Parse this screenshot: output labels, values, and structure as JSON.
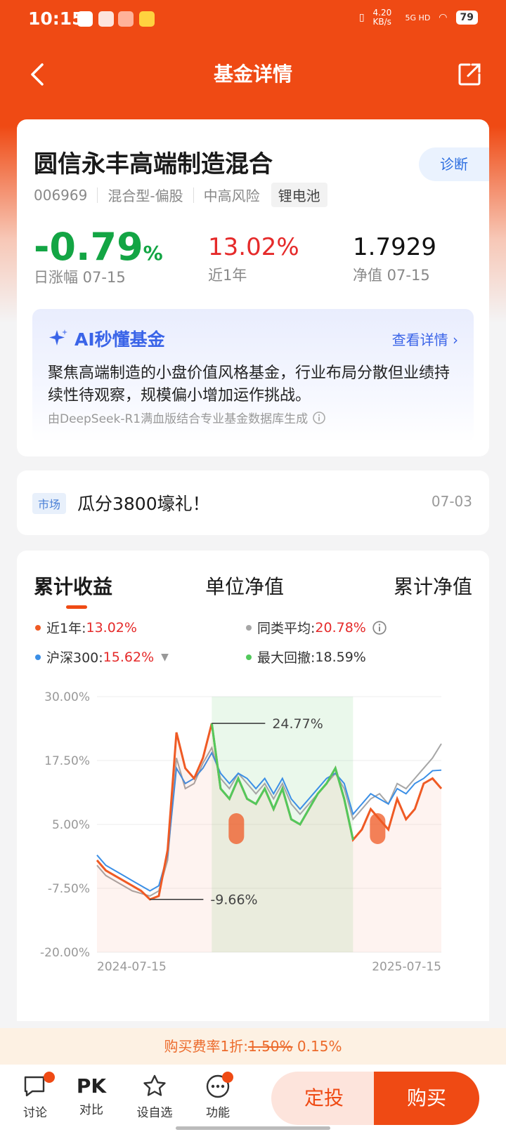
{
  "status": {
    "time": "10:15",
    "speed": "4.20 KB/s",
    "network": "5G HD",
    "battery": "79"
  },
  "nav": {
    "title": "基金详情"
  },
  "fund": {
    "name": "圆信永丰高端制造混合",
    "diagnose": "诊断",
    "code": "006969",
    "type": "混合型-偏股",
    "risk": "中高风险",
    "theme": "锂电池",
    "daily_change": "-0.79",
    "daily_change_unit": "%",
    "daily_label": "日涨幅 07-15",
    "year_return": "13.02%",
    "year_label": "近1年",
    "nav_value": "1.7929",
    "nav_label": "净值 07-15"
  },
  "ai": {
    "title": "AI秒懂基金",
    "link": "查看详情 ›",
    "text": "聚焦高端制造的小盘价值风格基金，行业布局分散但业绩持续性待观察，规模偏小增加运作挑战。",
    "source": "由DeepSeek-R1满血版结合专业基金数据库生成"
  },
  "news": {
    "badge": "市场",
    "text": "瓜分3800壕礼！",
    "date": "07-03"
  },
  "tabs": [
    "累计收益",
    "单位净值",
    "累计净值"
  ],
  "legend": {
    "fund_label": "近1年:",
    "fund_value": "13.02%",
    "avg_label": "同类平均:",
    "avg_value": "20.78%",
    "index_label": "沪深300:",
    "index_value": "15.62%",
    "dd_label": "最大回撤:",
    "dd_value": "18.59%"
  },
  "colors": {
    "fund": "#ef5a24",
    "avg": "#a6a6a6",
    "index": "#3b8fe6",
    "drawdown": "#52c95c"
  },
  "chart_data": {
    "type": "line",
    "y_ticks": [
      "30.00%",
      "17.50%",
      "5.00%",
      "-7.50%",
      "-20.00%"
    ],
    "ylim": [
      -20,
      30
    ],
    "x_labels": [
      "2024-07-15",
      "2025-07-15"
    ],
    "annotations": {
      "max": "24.77%",
      "min": "-9.66%"
    },
    "series": [
      {
        "name": "近1年",
        "values": [
          -2,
          -4,
          -5,
          -6,
          -7,
          -8,
          -9.66,
          -9,
          0,
          23,
          16,
          14,
          18,
          24.77,
          12,
          10,
          14,
          10,
          9,
          12,
          8,
          12,
          6,
          5,
          8,
          11,
          13,
          16,
          10,
          2,
          4,
          8,
          6,
          4,
          10,
          6,
          8,
          13,
          14,
          12
        ]
      },
      {
        "name": "同类平均",
        "values": [
          -3,
          -5,
          -6,
          -7,
          -8,
          -8.5,
          -9,
          -8,
          -2,
          18,
          12,
          13,
          17,
          20,
          14,
          12,
          15,
          13,
          11,
          13,
          10,
          13,
          9,
          7,
          9,
          11,
          13,
          15,
          12,
          6,
          8,
          10,
          11,
          9,
          13,
          12,
          14,
          16,
          18,
          20.78
        ]
      },
      {
        "name": "沪深300",
        "values": [
          -1,
          -3,
          -4,
          -5,
          -6,
          -7,
          -8,
          -7,
          -1,
          16,
          13,
          14,
          16,
          19,
          15,
          13,
          15,
          14,
          12,
          14,
          11,
          14,
          10,
          8,
          10,
          12,
          14,
          15,
          13,
          7,
          9,
          11,
          10,
          9,
          12,
          11,
          13,
          14,
          15.5,
          15.62
        ]
      }
    ],
    "max_drawdown": "18.59%"
  }
}
